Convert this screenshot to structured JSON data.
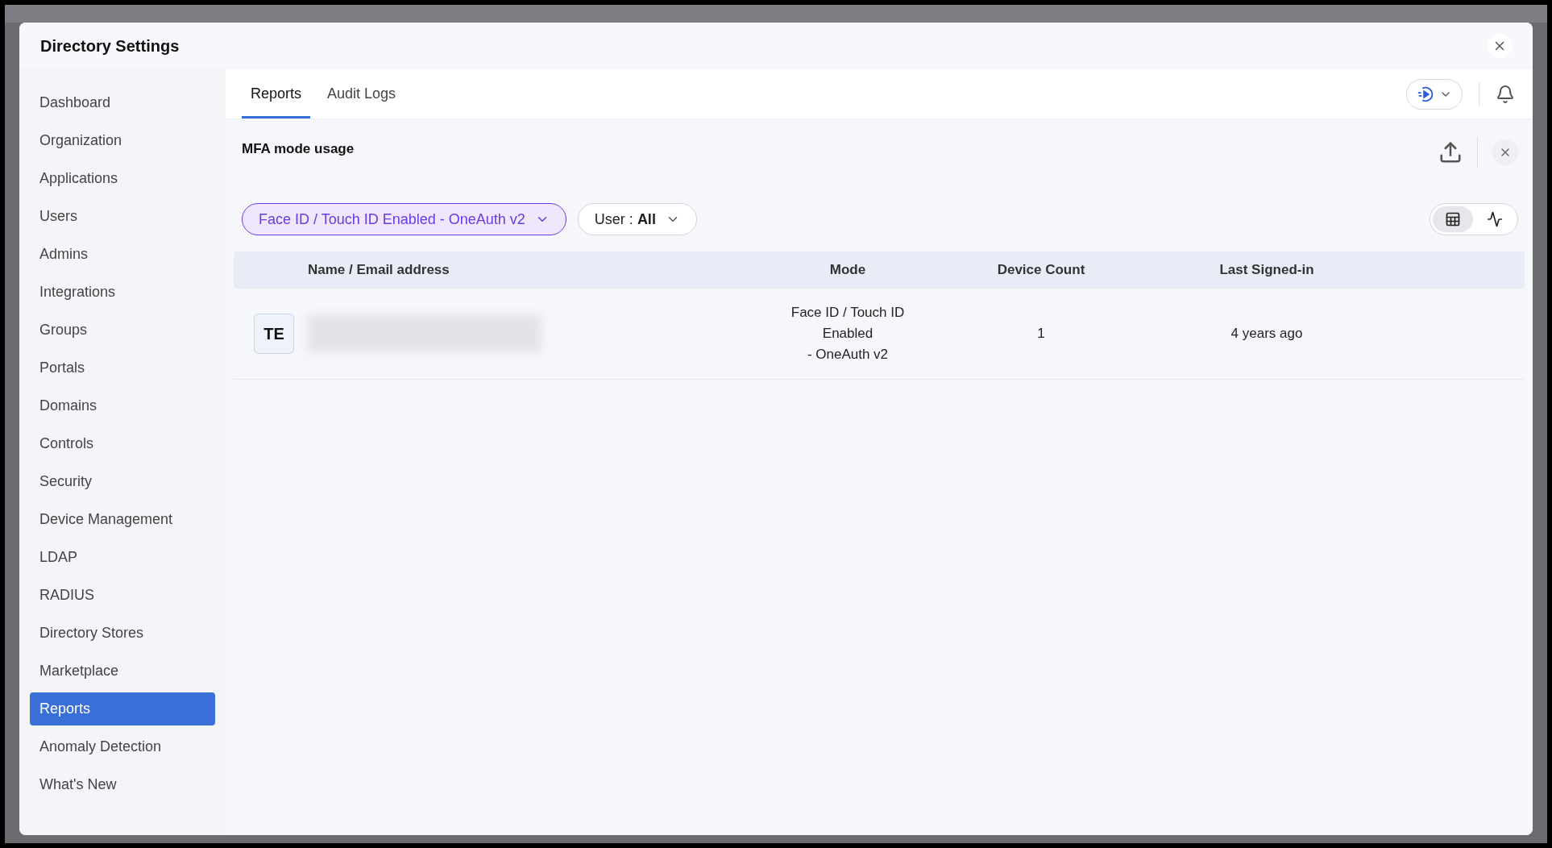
{
  "window": {
    "title": "Directory Settings"
  },
  "sidebar": {
    "items": [
      {
        "label": "Dashboard",
        "selected": false
      },
      {
        "label": "Organization",
        "selected": false
      },
      {
        "label": "Applications",
        "selected": false
      },
      {
        "label": "Users",
        "selected": false
      },
      {
        "label": "Admins",
        "selected": false
      },
      {
        "label": "Integrations",
        "selected": false
      },
      {
        "label": "Groups",
        "selected": false
      },
      {
        "label": "Portals",
        "selected": false
      },
      {
        "label": "Domains",
        "selected": false
      },
      {
        "label": "Controls",
        "selected": false
      },
      {
        "label": "Security",
        "selected": false
      },
      {
        "label": "Device Management",
        "selected": false
      },
      {
        "label": "LDAP",
        "selected": false
      },
      {
        "label": "RADIUS",
        "selected": false
      },
      {
        "label": "Directory Stores",
        "selected": false
      },
      {
        "label": "Marketplace",
        "selected": false
      },
      {
        "label": "Reports",
        "selected": true
      },
      {
        "label": "Anomaly Detection",
        "selected": false
      },
      {
        "label": "What's New",
        "selected": false
      }
    ]
  },
  "tabs": [
    {
      "label": "Reports",
      "selected": true
    },
    {
      "label": "Audit Logs",
      "selected": false
    }
  ],
  "report": {
    "title": "MFA mode usage",
    "filters": [
      {
        "kind": "mode",
        "label": "Face ID / Touch ID Enabled - OneAuth v2"
      },
      {
        "kind": "user",
        "label": "User : ",
        "value": "All"
      }
    ],
    "views": [
      {
        "kind": "table",
        "selected": true
      },
      {
        "kind": "chart",
        "selected": false
      }
    ],
    "table": {
      "columns": [
        "Name / Email address",
        "Mode",
        "Device Count",
        "Last Signed-in"
      ],
      "rows": [
        {
          "initials": "TE",
          "mode": [
            "Face ID / Touch ID",
            "Enabled",
            "- OneAuth v2"
          ],
          "device_count": "1",
          "last_signed_in": "4 years ago"
        }
      ]
    }
  }
}
